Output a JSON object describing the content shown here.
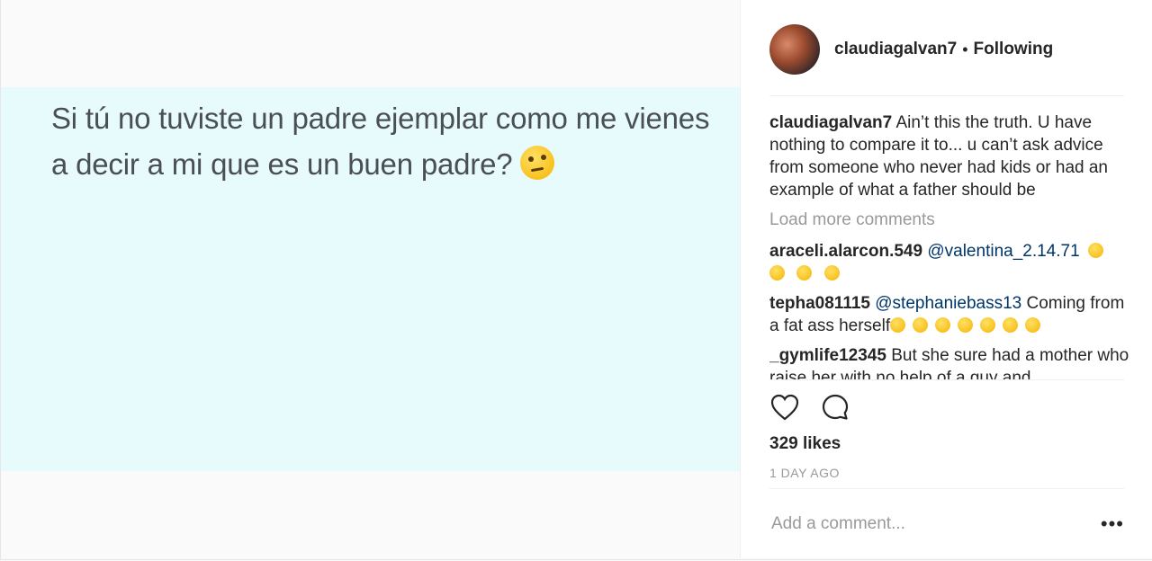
{
  "media": {
    "text": "Si tú no tuviste un padre ejemplar como me vienes a decir a mi que es un buen padre?",
    "emoji_icon": "thinking-face-emoji"
  },
  "header": {
    "username": "claudiagalvan7",
    "separator": "•",
    "follow_status": "Following"
  },
  "caption": {
    "username": "claudiagalvan7",
    "text": "Ain’t this the truth. U have nothing to compare it to... u can’t ask advice from someone who never had kids or had an example of what a father should be"
  },
  "load_more": "Load more comments",
  "comments": [
    {
      "username": "araceli.alarcon.549",
      "mention": "@valentina_2.14.71",
      "text": "",
      "emojis": [
        "squinting-tongue-emoji",
        "squinting-tongue-emoji",
        "squinting-tongue-emoji",
        "squinting-tongue-emoji"
      ]
    },
    {
      "username": "tepha081115",
      "mention": "@stephaniebass13",
      "text": "Coming from a fat ass herself",
      "emojis": [
        "tears-of-joy-emoji",
        "tears-of-joy-emoji",
        "tears-of-joy-emoji",
        "rofl-emoji",
        "rofl-emoji",
        "rofl-emoji",
        "rofl-emoji"
      ]
    },
    {
      "username": "_gymlife12345",
      "mention": "",
      "text": "But she sure had a mother who raise her with no help of a guy and",
      "emojis": []
    }
  ],
  "actions": {
    "like_icon": "heart-icon",
    "comment_icon": "comment-bubble-icon"
  },
  "likes": "329 likes",
  "timestamp": "1 DAY AGO",
  "add_comment": {
    "placeholder": "Add a comment...",
    "more_icon": "ellipsis-icon"
  }
}
